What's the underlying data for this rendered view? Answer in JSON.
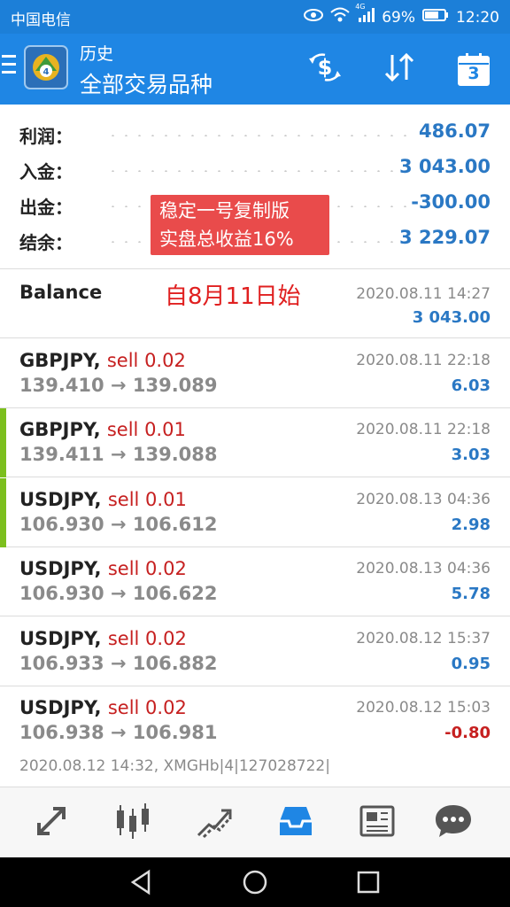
{
  "status_bar": {
    "carrier": "中国电信",
    "network": "4G",
    "battery": "69%",
    "time": "12:20"
  },
  "app_bar": {
    "subtitle": "历史",
    "title": "全部交易品种",
    "calendar_day": "3"
  },
  "summary": [
    {
      "label": "利润：",
      "value": "486.07"
    },
    {
      "label": "入金：",
      "value": "3 043.00"
    },
    {
      "label": "出金：",
      "value": "-300.00"
    },
    {
      "label": "结余：",
      "value": "3 229.07"
    }
  ],
  "overlay": {
    "badge_line1": "稳定一号复制版",
    "badge_line2": "实盘总收益16%",
    "start_note": "自8月11日始"
  },
  "balance": {
    "label": "Balance",
    "time": "2020.08.11 14:27",
    "amount": "3 043.00"
  },
  "deals": [
    {
      "symbol": "GBPJPY,",
      "side": "sell 0.02",
      "prices": "139.410 → 139.089",
      "time": "2020.08.11 22:18",
      "profit": "6.03",
      "accent": false
    },
    {
      "symbol": "GBPJPY,",
      "side": "sell 0.01",
      "prices": "139.411 → 139.088",
      "time": "2020.08.11 22:18",
      "profit": "3.03",
      "accent": true
    },
    {
      "symbol": "USDJPY,",
      "side": "sell 0.01",
      "prices": "106.930 → 106.612",
      "time": "2020.08.13 04:36",
      "profit": "2.98",
      "accent": true
    },
    {
      "symbol": "USDJPY,",
      "side": "sell 0.02",
      "prices": "106.930 → 106.622",
      "time": "2020.08.13 04:36",
      "profit": "5.78",
      "accent": false
    },
    {
      "symbol": "USDJPY,",
      "side": "sell 0.02",
      "prices": "106.933 → 106.882",
      "time": "2020.08.12 15:37",
      "profit": "0.95",
      "accent": false
    },
    {
      "symbol": "USDJPY,",
      "side": "sell 0.02",
      "prices": "106.938 → 106.981",
      "time": "2020.08.12 15:03",
      "profit": "-0.80",
      "accent": false
    }
  ],
  "last_deal_comment": "2020.08.12 14:32, XMGHb|4|127028722|",
  "colors": {
    "primary": "#1f86e4",
    "value_blue": "#2a78c4",
    "sell_red": "#c62020",
    "accent_green": "#7cbf1e",
    "active_tab": "#1f86e4"
  },
  "bottom_nav_icons": [
    "quotes-icon",
    "chart-icon",
    "trade-icon",
    "history-icon",
    "news-icon",
    "chat-icon"
  ],
  "bottom_nav_active": "history-icon"
}
